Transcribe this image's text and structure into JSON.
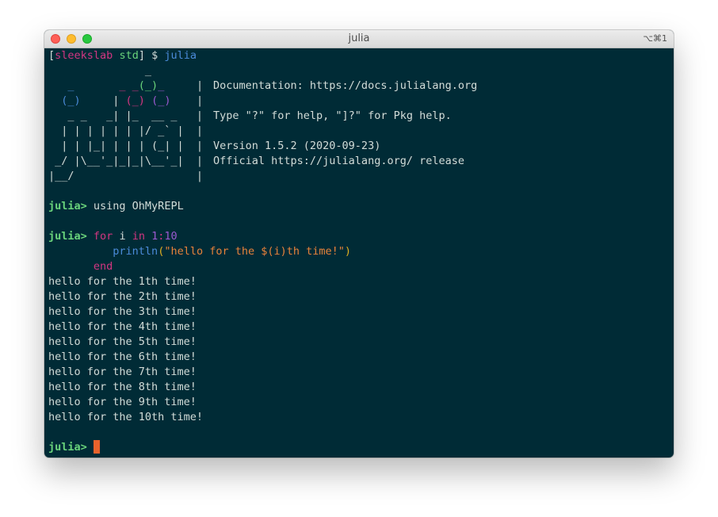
{
  "window": {
    "title": "julia",
    "shortcut": "⌥⌘1"
  },
  "shell": {
    "bracket_open": "[",
    "user": "sleekslab",
    "dir": "std",
    "bracket_close": "]",
    "dollar": " $ ",
    "command": "julia"
  },
  "banner": {
    "logo": [
      "               _",
      "   _       _ _(_)_     |",
      "  (_)     | (_) (_)    |",
      "   _ _   _| |_  __ _   |",
      "  | | | | | | |/ _` |  |",
      "  | | |_| | | | (_| |  |",
      " _/ |\\__'_|_|_|\\__'_|  |",
      "|__/                   |"
    ],
    "info": [
      "",
      "Documentation: https://docs.julialang.org",
      "",
      "Type \"?\" for help, \"]?\" for Pkg help.",
      "",
      "Version 1.5.2 (2020-09-23)",
      "Official https://julialang.org/ release",
      ""
    ]
  },
  "repl": {
    "prompt": "julia>",
    "cmd1": " using OhMyREPL",
    "for_kw": "for",
    "var_i": " i ",
    "in_kw": "in",
    "range_start": "1",
    "range_colon": ":",
    "range_end": "10",
    "indent": "          ",
    "func": "println",
    "paren_open": "(",
    "string": "\"hello for the $(i)th time!\"",
    "paren_close": ")",
    "end_indent": "       ",
    "end_kw": "end"
  },
  "output": [
    "hello for the 1th time!",
    "hello for the 2th time!",
    "hello for the 3th time!",
    "hello for the 4th time!",
    "hello for the 5th time!",
    "hello for the 6th time!",
    "hello for the 7th time!",
    "hello for the 8th time!",
    "hello for the 9th time!",
    "hello for the 10th time!"
  ],
  "colors": {
    "terminal_bg": "#002b36",
    "prompt": "#6ad47c",
    "keyword": "#d33682",
    "number": "#9b59d0",
    "function": "#4b8bd9",
    "string": "#e8823a",
    "cursor": "#e8622c"
  }
}
